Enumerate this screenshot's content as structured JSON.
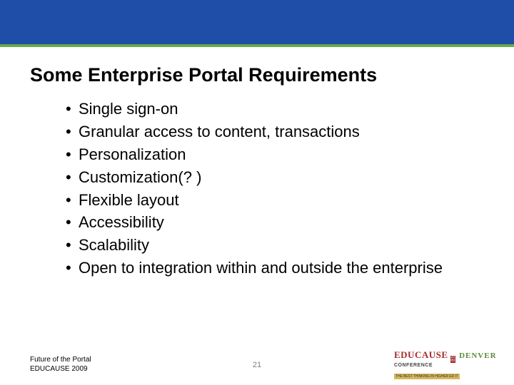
{
  "title": "Some Enterprise Portal Requirements",
  "bullets": [
    "Single sign-on",
    "Granular access to content, transactions",
    "Personalization",
    "Customization(? )",
    "Flexible layout",
    "Accessibility",
    "Scalability",
    "Open to integration within and outside the enterprise"
  ],
  "footer": {
    "line1": "Future of the Portal",
    "line2": "EDUCAUSE 2009"
  },
  "page_number": "21",
  "logo": {
    "brand": "EDUCAUSE",
    "year": "2009",
    "location": "DENVER",
    "conference": "CONFERENCE",
    "tagline": "THE BEST THINKING IN HIGHER ED IT"
  }
}
